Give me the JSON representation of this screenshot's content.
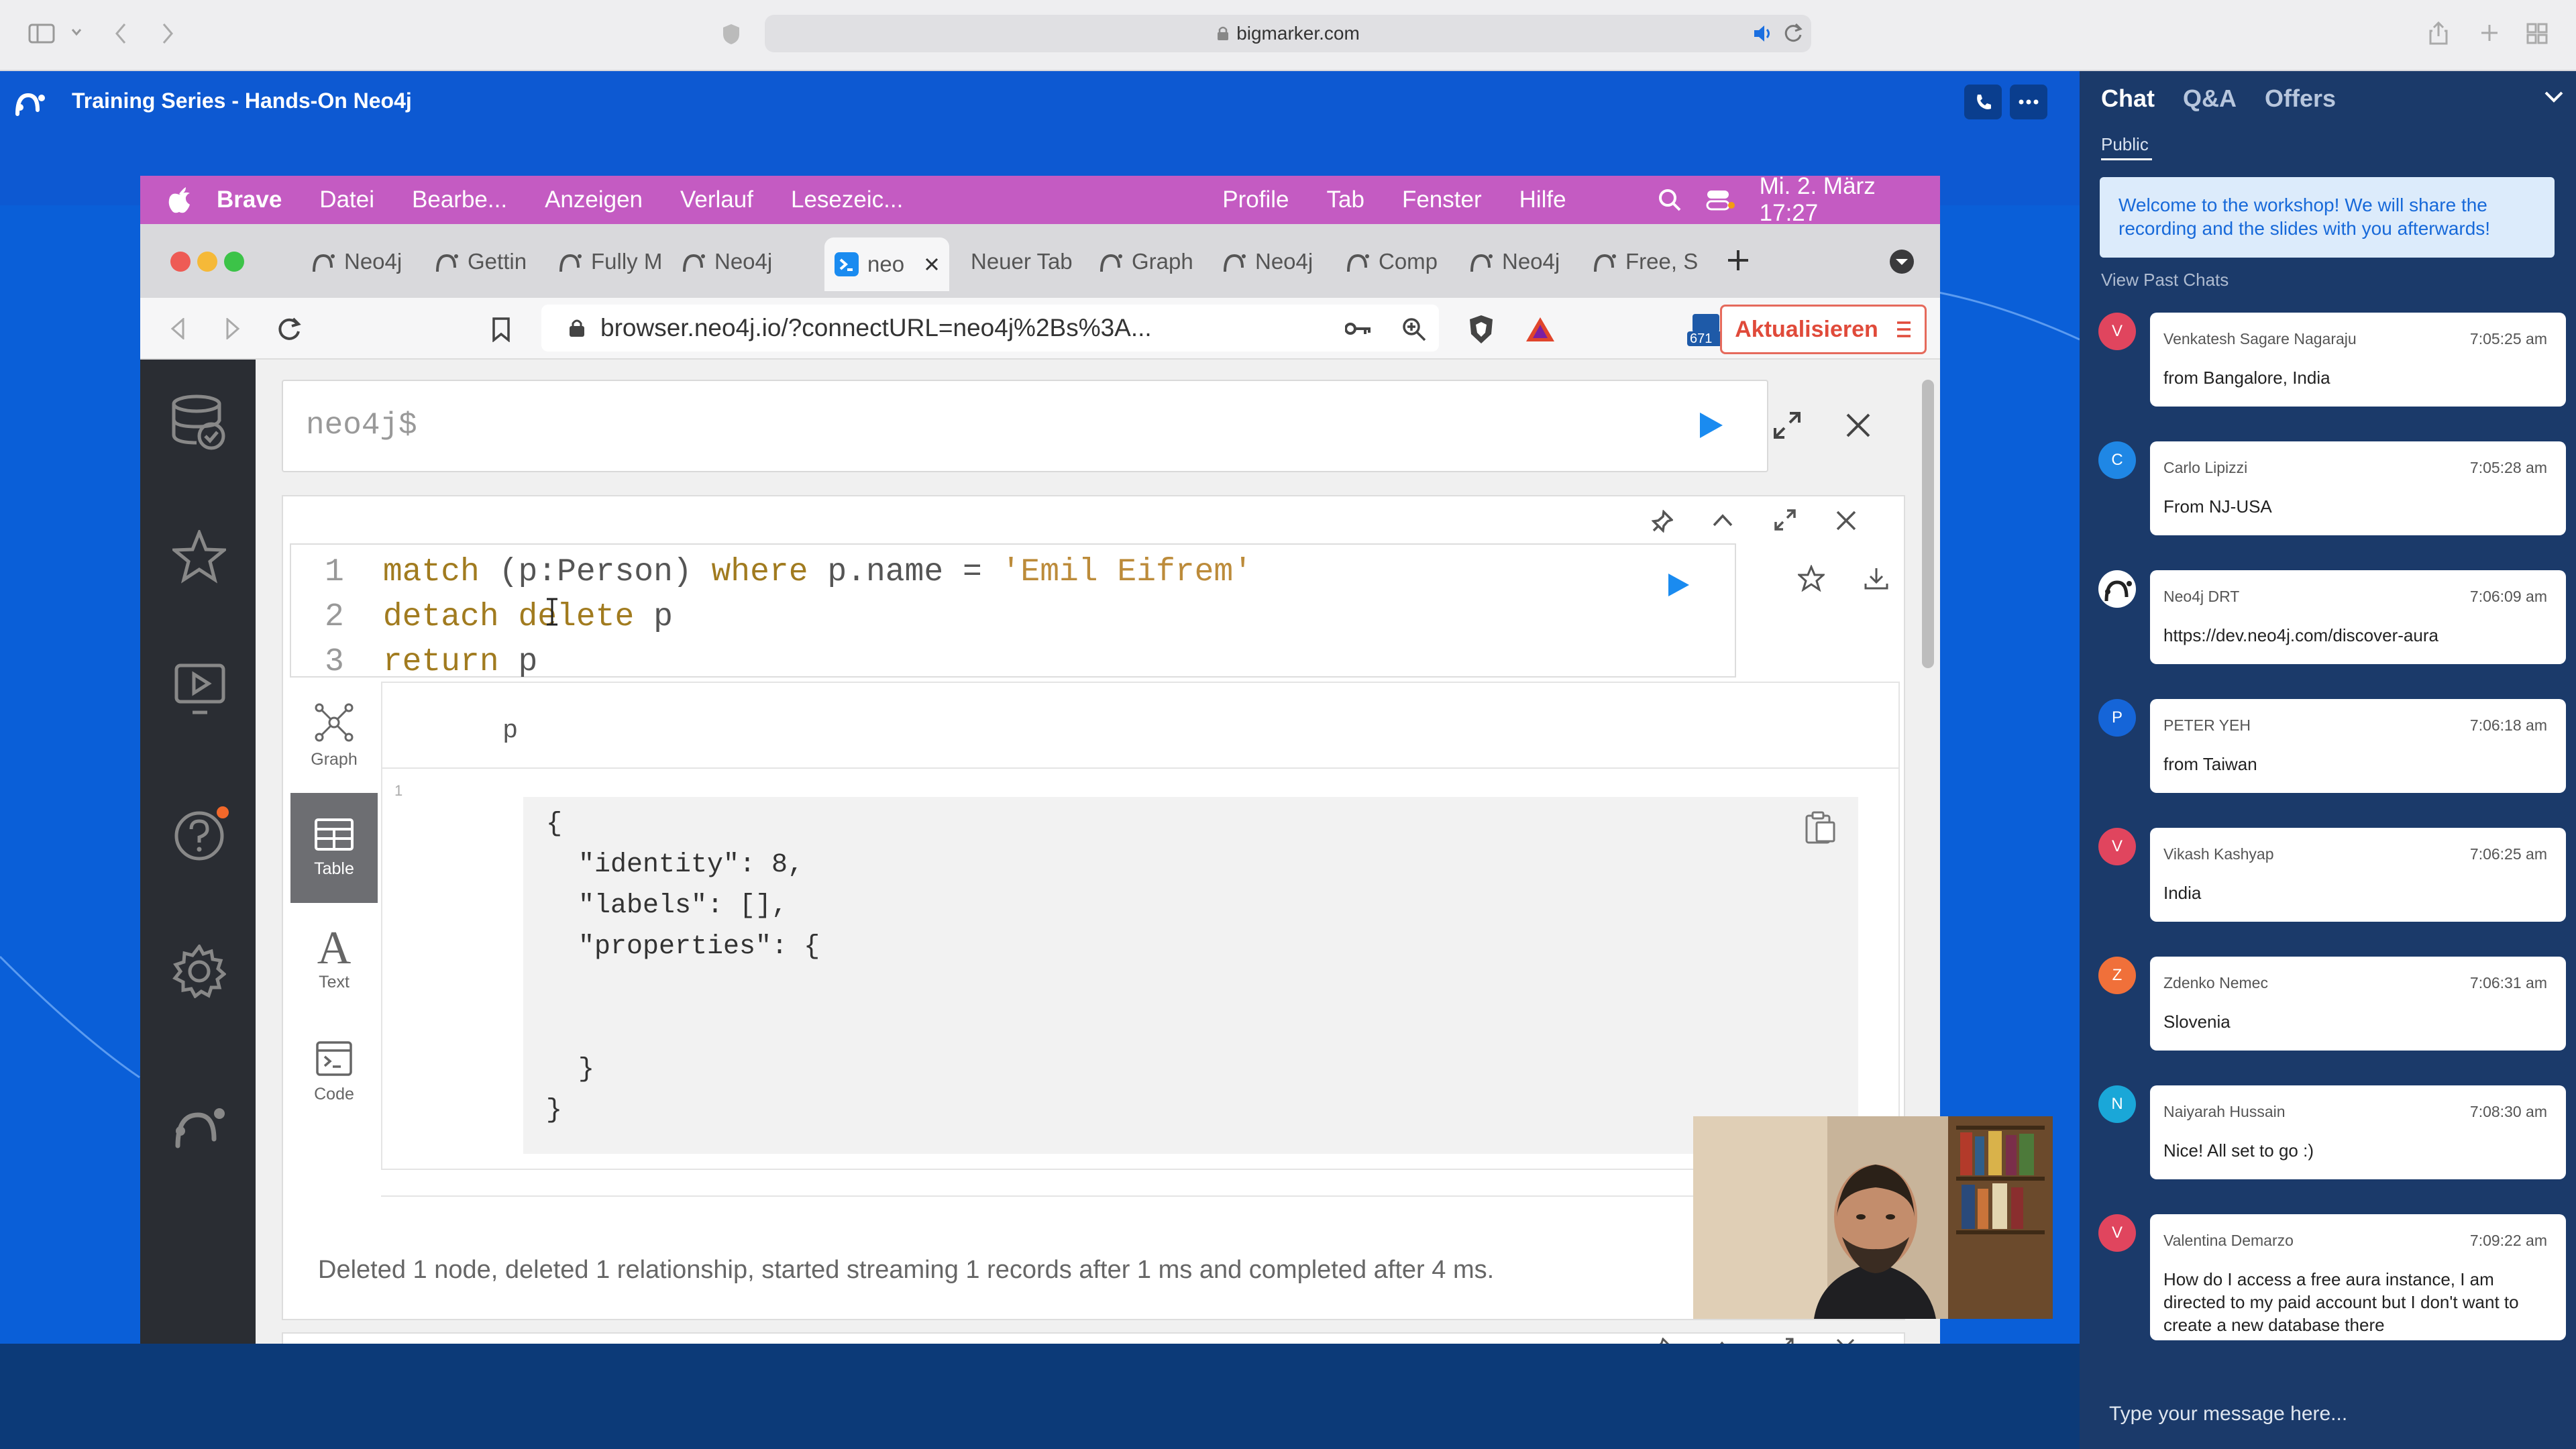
{
  "browser": {
    "url": "bigmarker.com"
  },
  "bigmarker": {
    "title": "Training Series - Hands-On Neo4j"
  },
  "mac_menu": {
    "app": "Brave",
    "items": [
      "Datei",
      "Bearbe...",
      "Anzeigen",
      "Verlauf",
      "Lesezeic..."
    ],
    "right_items": [
      "Profile",
      "Tab",
      "Fenster",
      "Hilfe"
    ],
    "clock": "Mi. 2. März  17:27"
  },
  "brave": {
    "tabs": [
      "Neo4j",
      "Gettin",
      "Fully M",
      "Neo4j",
      "neo",
      "Neuer Tab",
      "Graph",
      "Neo4j",
      "Comp",
      "Neo4j",
      "Free, S"
    ],
    "address": "browser.neo4j.io/?connectURL=neo4j%2Bs%3A...",
    "badge_count": "671",
    "update_button": "Aktualisieren"
  },
  "neo4j": {
    "prompt": "neo4j$",
    "query_lines": [
      {
        "no": "1",
        "parts": [
          {
            "t": "match",
            "c": "kw"
          },
          {
            "t": " (p:Person) ",
            "c": "pl"
          },
          {
            "t": "where",
            "c": "kw"
          },
          {
            "t": " p.name = ",
            "c": "pl"
          },
          {
            "t": "'Emil Eifrem'",
            "c": "st"
          }
        ]
      },
      {
        "no": "2",
        "parts": [
          {
            "t": "detach delete",
            "c": "kw"
          },
          {
            "t": " p",
            "c": "pl"
          }
        ]
      },
      {
        "no": "3",
        "parts": [
          {
            "t": "return",
            "c": "kw"
          },
          {
            "t": " p",
            "c": "pl"
          }
        ]
      }
    ],
    "result_tabs": [
      "Graph",
      "Table",
      "Text",
      "Code"
    ],
    "active_tab": "Table",
    "column_header": "p",
    "row_number": "1",
    "json_lines": [
      "{",
      "  \"identity\": 8,",
      "  \"labels\": [],",
      "  \"properties\": {",
      "",
      "",
      "  }",
      "}"
    ],
    "status": "Deleted 1 node, deleted 1 relationship, started streaming 1 records after 1 ms and completed after 4 ms."
  },
  "chat": {
    "tabs": [
      "Chat",
      "Q&A",
      "Offers"
    ],
    "active_tab": "Chat",
    "subtab": "Public",
    "welcome": "Welcome to the workshop! We will share the recording and the slides with you afterwards!",
    "view_past": "View Past Chats",
    "messages": [
      {
        "initial": "V",
        "color": "#e0455e",
        "name": "Venkatesh Sagare Nagaraju",
        "time": "7:05:25 am",
        "text": "from Bangalore, India"
      },
      {
        "initial": "C",
        "color": "#1f87e5",
        "name": "Carlo Lipizzi",
        "time": "7:05:28 am",
        "text": "From NJ-USA"
      },
      {
        "initial": "",
        "color": "#ffffff",
        "name": "Neo4j DRT",
        "time": "7:06:09 am",
        "text": "https://dev.neo4j.com/discover-aura"
      },
      {
        "initial": "P",
        "color": "#1565d8",
        "name": "PETER YEH",
        "time": "7:06:18 am",
        "text": "from Taiwan"
      },
      {
        "initial": "V",
        "color": "#e0455e",
        "name": "Vikash Kashyap",
        "time": "7:06:25 am",
        "text": "India"
      },
      {
        "initial": "Z",
        "color": "#f0703a",
        "name": "Zdenko Nemec",
        "time": "7:06:31 am",
        "text": "Slovenia"
      },
      {
        "initial": "N",
        "color": "#1aa7d8",
        "name": "Naiyarah Hussain",
        "time": "7:08:30 am",
        "text": "Nice! All set to go :)"
      },
      {
        "initial": "V",
        "color": "#e0455e",
        "name": "Valentina Demarzo",
        "time": "7:09:22 am",
        "text": "How do I access a free aura instance,  I am directed to my paid account but I don't want to create a new database there"
      }
    ],
    "input_placeholder": "Type your message here..."
  }
}
